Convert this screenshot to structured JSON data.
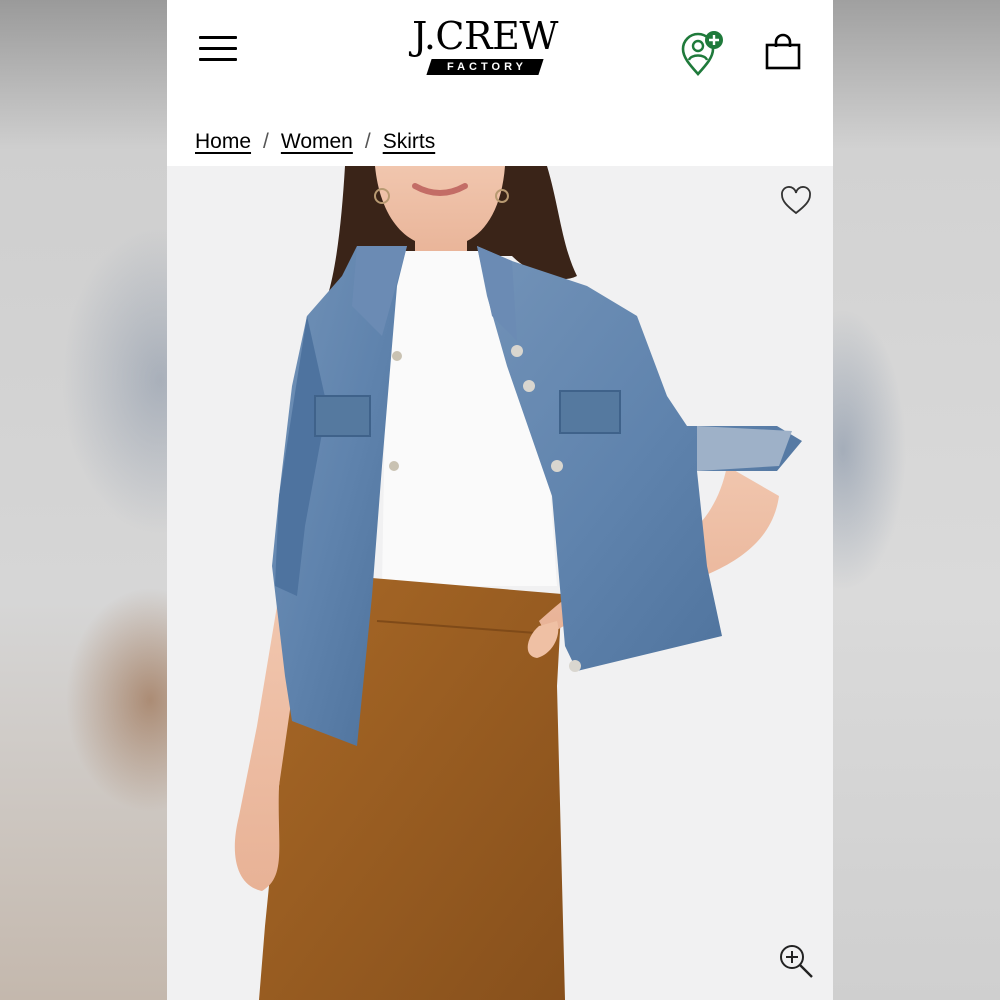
{
  "header": {
    "brand_name": "J.CREW",
    "brand_sub": "FACTORY",
    "menu_icon": "hamburger-menu-icon",
    "account_icon": "account-add-icon",
    "bag_icon": "shopping-bag-icon",
    "accent_color": "#1f7a3b"
  },
  "breadcrumb": {
    "items": [
      {
        "label": "Home"
      },
      {
        "label": "Women"
      },
      {
        "label": "Skirts"
      }
    ],
    "separator": "/"
  },
  "product": {
    "wishlist_icon": "heart-icon",
    "zoom_icon": "zoom-in-icon",
    "colors": {
      "jacket": "#5f83ad",
      "skirt": "#9a5a22",
      "top": "#fafafa",
      "background": "#f1f1f2"
    }
  }
}
